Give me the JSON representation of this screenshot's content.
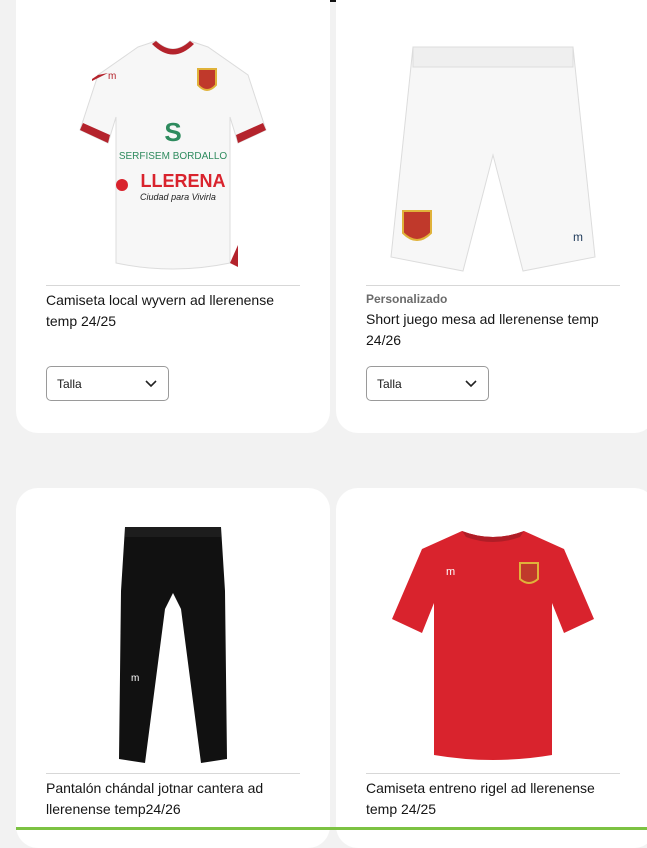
{
  "products": [
    {
      "title": "Camiseta local wyvern ad llerenense temp 24/25",
      "tag": "",
      "size_label": "Talla",
      "image_icon": "white-home-jersey",
      "shirt_text": {
        "sponsor1": "SERFISEM  BORDALLO",
        "sponsor2": "LLERENA",
        "slogan": "Ciudad para Vivirla"
      }
    },
    {
      "title": "Short juego mesa ad llerenense temp 24/26",
      "tag": "Personalizado",
      "size_label": "Talla",
      "image_icon": "white-shorts"
    },
    {
      "title": "Pantalón chándal jotnar cantera ad llerenense temp24/26",
      "tag": "",
      "image_icon": "black-tracksuit-pants"
    },
    {
      "title": "Camiseta entreno rigel ad llerenense temp 24/25",
      "tag": "",
      "image_icon": "red-training-shirt"
    }
  ],
  "colors": {
    "background": "#f2f2f2",
    "card": "#ffffff",
    "jersey_accent": "#b4232c",
    "training_red": "#d9232d",
    "accent_bar": "#7cc242"
  }
}
